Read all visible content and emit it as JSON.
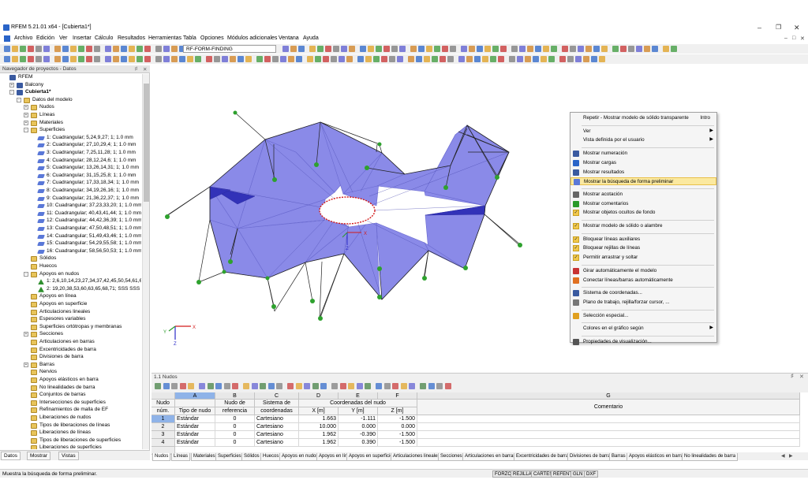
{
  "window": {
    "title": "RFEM 5.21.01 x64 - [Cubierta1*]"
  },
  "menu": [
    "Archivo",
    "Edición",
    "Ver",
    "Insertar",
    "Cálculo",
    "Resultados",
    "Herramientas",
    "Tabla",
    "Opciones",
    "Módulos adicionales",
    "Ventana",
    "Ayuda"
  ],
  "toolbar": {
    "module_combo": "RF-FORM-FINDING"
  },
  "navigator": {
    "title": "Navegador de proyectos - Datos",
    "items": [
      {
        "label": "RFEM",
        "level": 0,
        "toggle": "",
        "icon": "mdl",
        "bold": false
      },
      {
        "label": "Balcony",
        "level": 1,
        "toggle": "+",
        "icon": "mdl",
        "bold": false
      },
      {
        "label": "Cubierta1*",
        "level": 1,
        "toggle": "-",
        "icon": "mdl",
        "bold": true
      },
      {
        "label": "Datos del modelo",
        "level": 2,
        "toggle": "-",
        "icon": "fold",
        "bold": false
      },
      {
        "label": "Nudos",
        "level": 3,
        "toggle": "+",
        "icon": "fold",
        "bold": false
      },
      {
        "label": "Líneas",
        "level": 3,
        "toggle": "+",
        "icon": "fold",
        "bold": false
      },
      {
        "label": "Materiales",
        "level": 3,
        "toggle": "+",
        "icon": "fold",
        "bold": false
      },
      {
        "label": "Superficies",
        "level": 3,
        "toggle": "-",
        "icon": "fold",
        "bold": false
      },
      {
        "label": "1: Cuadrangular; 5,24,9,27; 1; 1.0 mm",
        "level": 4,
        "toggle": "",
        "icon": "surf",
        "bold": false
      },
      {
        "label": "2: Cuadrangular; 27,10,29,4; 1; 1.0 mm",
        "level": 4,
        "toggle": "",
        "icon": "surf",
        "bold": false
      },
      {
        "label": "3: Cuadrangular; 7,25,11,28; 1; 1.0 mm",
        "level": 4,
        "toggle": "",
        "icon": "surf",
        "bold": false
      },
      {
        "label": "4: Cuadrangular; 28,12,24,6; 1; 1.0 mm",
        "level": 4,
        "toggle": "",
        "icon": "surf",
        "bold": false
      },
      {
        "label": "5: Cuadrangular; 13,26,14,31; 1; 1.0 mm",
        "level": 4,
        "toggle": "",
        "icon": "surf",
        "bold": false
      },
      {
        "label": "6: Cuadrangular; 31,15,25,8; 1; 1.0 mm",
        "level": 4,
        "toggle": "",
        "icon": "surf",
        "bold": false
      },
      {
        "label": "7: Cuadrangular; 17,33,18,34; 1; 1.0 mm",
        "level": 4,
        "toggle": "",
        "icon": "surf",
        "bold": false
      },
      {
        "label": "8: Cuadrangular; 34,19,26,16; 1; 1.0 mm",
        "level": 4,
        "toggle": "",
        "icon": "surf",
        "bold": false
      },
      {
        "label": "9: Cuadrangular; 21,36,22,37; 1; 1.0 mm",
        "level": 4,
        "toggle": "",
        "icon": "surf",
        "bold": false
      },
      {
        "label": "10: Cuadrangular; 37,23,33,20; 1; 1.0 mm",
        "level": 4,
        "toggle": "",
        "icon": "surf",
        "bold": false
      },
      {
        "label": "11: Cuadrangular; 40,43,41,44; 1; 1.0 mm",
        "level": 4,
        "toggle": "",
        "icon": "surf",
        "bold": false
      },
      {
        "label": "12: Cuadrangular; 44,42,36,39; 1; 1.0 mm",
        "level": 4,
        "toggle": "",
        "icon": "surf",
        "bold": false
      },
      {
        "label": "13: Cuadrangular; 47,50,48,51; 1; 1.0 mm",
        "level": 4,
        "toggle": "",
        "icon": "surf",
        "bold": false
      },
      {
        "label": "14: Cuadrangular; 51,49,43,46; 1; 1.0 mm",
        "level": 4,
        "toggle": "",
        "icon": "surf",
        "bold": false
      },
      {
        "label": "15: Cuadrangular; 54,29,55,58; 1; 1.0 mm",
        "level": 4,
        "toggle": "",
        "icon": "surf",
        "bold": false
      },
      {
        "label": "16: Cuadrangular; 58,56,50,53; 1; 1.0 mm",
        "level": 4,
        "toggle": "",
        "icon": "surf",
        "bold": false
      },
      {
        "label": "Sólidos",
        "level": 3,
        "toggle": "",
        "icon": "fold",
        "bold": false
      },
      {
        "label": "Huecos",
        "level": 3,
        "toggle": "",
        "icon": "fold",
        "bold": false
      },
      {
        "label": "Apoyos en nudos",
        "level": 3,
        "toggle": "-",
        "icon": "fold",
        "bold": false
      },
      {
        "label": "1: 2,6,10,14,23,27,34,37,42,45,50,54,61,66,69,7",
        "level": 4,
        "toggle": "",
        "icon": "sup",
        "bold": false
      },
      {
        "label": "2: 19,20,38,53,60,63,65,68,71; SSS SSS",
        "level": 4,
        "toggle": "",
        "icon": "sup",
        "bold": false
      },
      {
        "label": "Apoyos en línea",
        "level": 3,
        "toggle": "",
        "icon": "fold",
        "bold": false
      },
      {
        "label": "Apoyos en superficie",
        "level": 3,
        "toggle": "",
        "icon": "fold",
        "bold": false
      },
      {
        "label": "Articulaciones lineales",
        "level": 3,
        "toggle": "",
        "icon": "fold",
        "bold": false
      },
      {
        "label": "Espesores variables",
        "level": 3,
        "toggle": "",
        "icon": "fold",
        "bold": false
      },
      {
        "label": "Superficies ortótropas y membranas",
        "level": 3,
        "toggle": "",
        "icon": "fold",
        "bold": false
      },
      {
        "label": "Secciones",
        "level": 3,
        "toggle": "+",
        "icon": "fold",
        "bold": false
      },
      {
        "label": "Articulaciones en barras",
        "level": 3,
        "toggle": "",
        "icon": "fold",
        "bold": false
      },
      {
        "label": "Excentricidades de barra",
        "level": 3,
        "toggle": "",
        "icon": "fold",
        "bold": false
      },
      {
        "label": "Divisiones de barra",
        "level": 3,
        "toggle": "",
        "icon": "fold",
        "bold": false
      },
      {
        "label": "Barras",
        "level": 3,
        "toggle": "+",
        "icon": "fold",
        "bold": false
      },
      {
        "label": "Nervios",
        "level": 3,
        "toggle": "",
        "icon": "fold",
        "bold": false
      },
      {
        "label": "Apoyos elásticos en barra",
        "level": 3,
        "toggle": "",
        "icon": "fold",
        "bold": false
      },
      {
        "label": "No linealidades de barra",
        "level": 3,
        "toggle": "",
        "icon": "fold",
        "bold": false
      },
      {
        "label": "Conjuntos de barras",
        "level": 3,
        "toggle": "",
        "icon": "fold",
        "bold": false
      },
      {
        "label": "Intersecciones de superficies",
        "level": 3,
        "toggle": "",
        "icon": "fold",
        "bold": false
      },
      {
        "label": "Refinamientos de malla de EF",
        "level": 3,
        "toggle": "",
        "icon": "fold",
        "bold": false
      },
      {
        "label": "Liberaciones de nudos",
        "level": 3,
        "toggle": "",
        "icon": "fold",
        "bold": false
      },
      {
        "label": "Tipos de liberaciones de líneas",
        "level": 3,
        "toggle": "",
        "icon": "fold",
        "bold": false
      },
      {
        "label": "Liberaciones de líneas",
        "level": 3,
        "toggle": "",
        "icon": "fold",
        "bold": false
      },
      {
        "label": "Tipos de liberaciones de superficies",
        "level": 3,
        "toggle": "",
        "icon": "fold",
        "bold": false
      },
      {
        "label": "Liberaciones de superficies",
        "level": 3,
        "toggle": "",
        "icon": "fold",
        "bold": false
      }
    ],
    "tabs": [
      "Datos",
      "Mostrar",
      "Vistas"
    ]
  },
  "context_menu": {
    "items": [
      {
        "type": "item",
        "label": "Repetir - Mostrar modelo de sólido transparente",
        "key": "Intro",
        "icon": "none"
      },
      {
        "type": "sep"
      },
      {
        "type": "item",
        "label": "Ver",
        "submenu": true,
        "icon": "none"
      },
      {
        "type": "item",
        "label": "Vista definida por el usuario",
        "submenu": true,
        "icon": "none"
      },
      {
        "type": "sep"
      },
      {
        "type": "item",
        "label": "Mostrar numeración",
        "icon": "numbers-icon"
      },
      {
        "type": "item",
        "label": "Mostrar cargas",
        "icon": "loads-icon"
      },
      {
        "type": "item",
        "label": "Mostrar resultados",
        "icon": "results-icon"
      },
      {
        "type": "item",
        "label": "Mostrar la búsqueda de forma preliminar",
        "icon": "form-finding-icon",
        "highlight": true
      },
      {
        "type": "sep"
      },
      {
        "type": "item",
        "label": "Mostrar acotación",
        "icon": "dimension-icon"
      },
      {
        "type": "item",
        "label": "Mostrar comentarios",
        "icon": "comment-icon"
      },
      {
        "type": "item",
        "label": "Mostrar objetos ocultos de fondo",
        "icon": "check-icon"
      },
      {
        "type": "sep"
      },
      {
        "type": "item",
        "label": "Mostrar modelo de sólido o alambre",
        "icon": "check-icon"
      },
      {
        "type": "sep"
      },
      {
        "type": "item",
        "label": "Bloquear líneas auxiliares",
        "icon": "check-icon"
      },
      {
        "type": "item",
        "label": "Bloquear rejillas de líneas",
        "icon": "check-icon"
      },
      {
        "type": "item",
        "label": "Permitir arrastrar y soltar",
        "icon": "check-icon"
      },
      {
        "type": "sep"
      },
      {
        "type": "item",
        "label": "Girar automáticamente el modelo",
        "icon": "rotate-icon"
      },
      {
        "type": "item",
        "label": "Conectar líneas/barras automáticamente",
        "icon": "connect-icon"
      },
      {
        "type": "sep"
      },
      {
        "type": "item",
        "label": "Sistema de coordenadas...",
        "icon": "coord-icon"
      },
      {
        "type": "item",
        "label": "Plano de trabajo, rejilla/forzar cursor, ...",
        "icon": "grid-icon"
      },
      {
        "type": "sep"
      },
      {
        "type": "item",
        "label": "Selección especial...",
        "icon": "select-icon"
      },
      {
        "type": "sep"
      },
      {
        "type": "item",
        "label": "Colores en el gráfico según",
        "submenu": true,
        "icon": "none"
      },
      {
        "type": "sep"
      },
      {
        "type": "item",
        "label": "Propiedades de visualización...",
        "icon": "props-icon"
      }
    ]
  },
  "table_panel": {
    "title": "1.1 Nudos",
    "column_letters": [
      "A",
      "B",
      "C",
      "D",
      "E",
      "F",
      "G"
    ],
    "header1": [
      "Nudo",
      "Nudo de",
      "Sistema de",
      "Coordenadas del nudo",
      "",
      "",
      "Comentario"
    ],
    "header_sub": {
      "num": "núm.",
      "type": "Tipo de nudo",
      "ref": "referencia",
      "sys": "coordenadas",
      "x": "X [m]",
      "y": "Y [m]",
      "z": "Z [m]"
    },
    "rows": [
      {
        "num": "1",
        "type": "Estándar",
        "ref": "0",
        "sys": "Cartesiano",
        "x": "1.663",
        "y": "-1.111",
        "z": "-1.500",
        "comment": ""
      },
      {
        "num": "2",
        "type": "Estándar",
        "ref": "0",
        "sys": "Cartesiano",
        "x": "10.000",
        "y": "0.000",
        "z": "0.000",
        "comment": ""
      },
      {
        "num": "3",
        "type": "Estándar",
        "ref": "0",
        "sys": "Cartesiano",
        "x": "1.962",
        "y": "-0.390",
        "z": "-1.500",
        "comment": ""
      },
      {
        "num": "4",
        "type": "Estándar",
        "ref": "0",
        "sys": "Cartesiano",
        "x": "1.962",
        "y": "0.390",
        "z": "-1.500",
        "comment": ""
      }
    ],
    "tabs": [
      "Nudos",
      "Líneas",
      "Materiales",
      "Superficies",
      "Sólidos",
      "Huecos",
      "Apoyos en nudos",
      "Apoyos en línea",
      "Apoyos en superficie",
      "Articulaciones lineales",
      "Secciones",
      "Articulaciones en barras",
      "Excentricidades de barra",
      "Divisiones de barra",
      "Barras",
      "Apoyos elásticos en barra",
      "No linealidades de barra"
    ]
  },
  "status": {
    "text": "Muestra la búsqueda de forma preliminar.",
    "buttons": [
      "FORZC",
      "REJILLA",
      "CARTES",
      "REFENT",
      "GLN",
      "DXF"
    ]
  },
  "axes": {
    "x": "X",
    "y": "Y",
    "z": "Z"
  },
  "colors": {
    "membrane": "#8a8ae8",
    "membrane_dark": "#3232b8",
    "support": "#2ea12e",
    "opening_edge": "#d21a1a",
    "highlight": "#fbe9a0",
    "selection": "#8fb3e8"
  }
}
